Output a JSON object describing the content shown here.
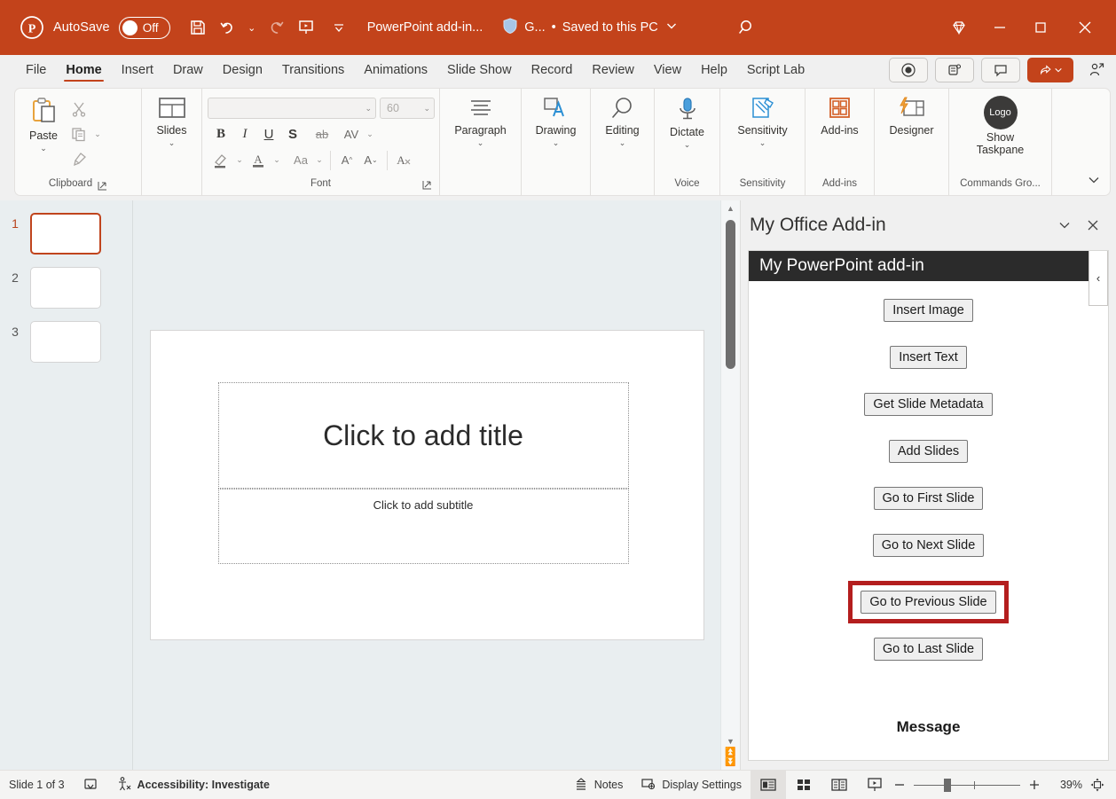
{
  "titlebar": {
    "app_icon": "powerpoint-logo-icon",
    "autosave_label": "AutoSave",
    "autosave_state": "Off",
    "save_icon": "save-icon",
    "undo_icon": "undo-icon",
    "redo_icon": "redo-icon",
    "present_icon": "start-presentation-icon",
    "customize_qat_icon": "chevron-down-icon",
    "document_title": "PowerPoint add-in...",
    "shield_icon": "shield-icon",
    "account_label": "G...",
    "separator_dot": "•",
    "save_state": "Saved to this PC",
    "save_state_chevron": "chevron-down-icon",
    "search_icon": "search-icon",
    "diamond_icon": "diamond-icon",
    "minimize_icon": "minimize-icon",
    "maximize_icon": "maximize-icon",
    "close_icon": "close-icon"
  },
  "tabs": [
    {
      "label": "File",
      "active": false
    },
    {
      "label": "Home",
      "active": true
    },
    {
      "label": "Insert",
      "active": false
    },
    {
      "label": "Draw",
      "active": false
    },
    {
      "label": "Design",
      "active": false
    },
    {
      "label": "Transitions",
      "active": false
    },
    {
      "label": "Animations",
      "active": false
    },
    {
      "label": "Slide Show",
      "active": false
    },
    {
      "label": "Record",
      "active": false
    },
    {
      "label": "Review",
      "active": false
    },
    {
      "label": "View",
      "active": false
    },
    {
      "label": "Help",
      "active": false
    },
    {
      "label": "Script Lab",
      "active": false
    }
  ],
  "tabstrip_buttons": {
    "record_icon": "record-circle-icon",
    "teams_icon": "teams-present-icon",
    "comments_icon": "comment-icon",
    "share_icon": "share-icon",
    "share_chevron": "chevron-down-icon",
    "people_icon": "person-share-icon"
  },
  "ribbon": {
    "clipboard": {
      "group_label": "Clipboard",
      "paste_label": "Paste",
      "paste_icon": "paste-icon",
      "paste_caret": "chevron-down-icon",
      "cut_icon": "scissors-icon",
      "copy_icon": "copy-icon",
      "copy_caret": "chevron-down-icon",
      "format_painter_icon": "format-painter-icon",
      "dialog_launcher_icon": "dialog-launcher-icon"
    },
    "slides": {
      "label": "Slides",
      "icon": "slide-layout-icon",
      "caret": "chevron-down-icon"
    },
    "font": {
      "group_label": "Font",
      "font_name_value": "",
      "font_name_placeholder": "",
      "font_size_value": "60",
      "bold": "B",
      "italic": "I",
      "underline": "U",
      "shadow": "S",
      "strikethrough": "ab",
      "character_spacing": "AV",
      "character_spacing_caret": "chevron-down-icon",
      "text_highlight_icon": "highlighter-icon",
      "text_highlight_caret": "chevron-down-icon",
      "font_color_icon": "font-color-icon",
      "font_color_caret": "chevron-down-icon",
      "change_case": "Aa",
      "change_case_caret": "chevron-down-icon",
      "increase_font": "A",
      "decrease_font": "A",
      "clear_formatting_icon": "clear-formatting-icon",
      "dialog_launcher_icon": "dialog-launcher-icon"
    },
    "paragraph": {
      "label": "Paragraph",
      "icon": "paragraph-lines-icon",
      "caret": "chevron-down-icon"
    },
    "drawing": {
      "label": "Drawing",
      "icon": "shape-text-icon",
      "caret": "chevron-down-icon"
    },
    "editing": {
      "label": "Editing",
      "icon": "magnifier-icon",
      "caret": "chevron-down-icon"
    },
    "voice": {
      "group_label": "Voice",
      "dictate_label": "Dictate",
      "dictate_icon": "microphone-icon",
      "caret": "chevron-down-icon"
    },
    "sensitivity": {
      "group_label": "Sensitivity",
      "label": "Sensitivity",
      "icon": "sensitivity-label-icon",
      "caret": "chevron-down-icon"
    },
    "addins": {
      "group_label": "Add-ins",
      "label": "Add-ins",
      "icon": "addins-grid-icon"
    },
    "designer": {
      "label": "Designer",
      "icon": "designer-icon"
    },
    "commands_group": {
      "group_label": "Commands Gro...",
      "show_taskpane_label": "Show Taskpane",
      "logo_text": "Logo"
    },
    "collapse_ribbon_icon": "chevron-down-icon"
  },
  "thumbnails": [
    {
      "number": "1",
      "selected": true
    },
    {
      "number": "2",
      "selected": false
    },
    {
      "number": "3",
      "selected": false
    }
  ],
  "slide": {
    "title_placeholder": "Click to add title",
    "subtitle_placeholder": "Click to add subtitle"
  },
  "scrollbar": {
    "up_arrow_icon": "triangle-up-icon",
    "down_arrow_icon": "triangle-down-icon",
    "prev_slide_icon": "double-up-icon",
    "next_slide_icon": "double-down-icon"
  },
  "taskpane": {
    "title": "My Office Add-in",
    "chevron_icon": "chevron-down-icon",
    "close_icon": "close-icon",
    "addin_header": "My PowerPoint add-in",
    "collapse_icon": "chevron-left-icon",
    "buttons": [
      {
        "label": "Insert Image",
        "highlighted": false
      },
      {
        "label": "Insert Text",
        "highlighted": false
      },
      {
        "label": "Get Slide Metadata",
        "highlighted": false
      },
      {
        "label": "Add Slides",
        "highlighted": false
      },
      {
        "label": "Go to First Slide",
        "highlighted": false
      },
      {
        "label": "Go to Next Slide",
        "highlighted": false
      },
      {
        "label": "Go to Previous Slide",
        "highlighted": true
      },
      {
        "label": "Go to Last Slide",
        "highlighted": false
      }
    ],
    "message_label": "Message",
    "highlight_color": "#b41e1e"
  },
  "statusbar": {
    "slide_count": "Slide 1 of 3",
    "language_icon": "proofing-icon",
    "accessibility_icon": "accessibility-icon",
    "accessibility_text": "Accessibility: Investigate",
    "notes_label": "Notes",
    "notes_icon": "notes-icon",
    "display_settings_label": "Display Settings",
    "display_settings_icon": "display-settings-icon",
    "view_normal_icon": "normal-view-icon",
    "view_sorter_icon": "slide-sorter-icon",
    "view_reading_icon": "reading-view-icon",
    "view_slideshow_icon": "slideshow-view-icon",
    "zoom_out_icon": "minus-icon",
    "zoom_in_icon": "plus-icon",
    "zoom_percent": "39%",
    "fit_slide_icon": "fit-to-window-icon"
  },
  "colors": {
    "accent": "#c3431b",
    "ribbon_bg": "#f0f0f0",
    "canvas_bg": "#e9eef0"
  }
}
